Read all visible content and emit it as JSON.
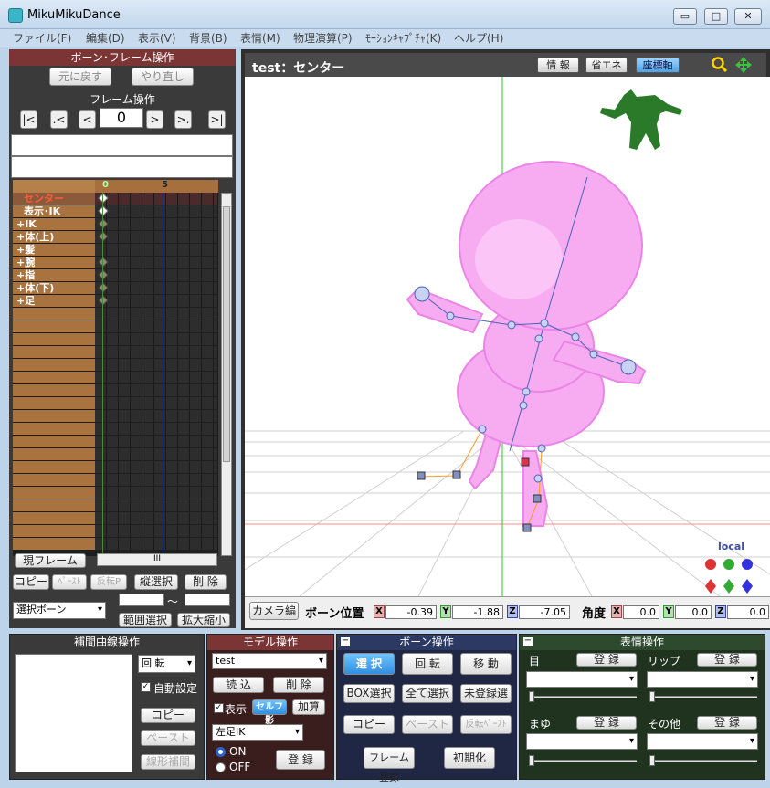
{
  "window": {
    "title": "MikuMikuDance",
    "minimize": "▭",
    "maximize": "□",
    "close": "✕"
  },
  "menu": [
    "ファイル(F)",
    "編集(D)",
    "表示(V)",
    "背景(B)",
    "表情(M)",
    "物理演算(P)",
    "ﾓｰｼｮﾝｷｬﾌﾟﾁｬ(K)",
    "ヘルプ(H)"
  ],
  "bone_frame_ops": {
    "title": "ボーン･フレーム操作",
    "undo": "元に戻す",
    "redo": "やり直し"
  },
  "frame_ops": {
    "title": "フレーム操作",
    "first": "|<",
    "prev_key": ".<",
    "prev": "<",
    "frame": "0",
    "next": ">",
    "next_key": ">.",
    "last": ">|"
  },
  "timeline": {
    "ruler": [
      "0",
      "5"
    ],
    "rows": [
      "センター",
      "表示･IK",
      "+IK",
      "+体(上)",
      "+髪",
      "+腕",
      "+指",
      "+体(下)",
      "+足"
    ],
    "current_frame": "現フレーム",
    "scroll_mid": "III",
    "copy": "コピー",
    "paste": "ﾍﾟｰｽﾄ",
    "reverse_paste": "反転P",
    "vertical_select": "縦選択",
    "delete": "削 除",
    "bone_select": "選択ボーン",
    "tilde": "～",
    "range_select": "範囲選択",
    "zoom": "拡大縮小"
  },
  "viewport": {
    "title": "test：センター",
    "info": "情 報",
    "eco": "省エネ",
    "axis": "座標軸",
    "local": "local",
    "camera_edit": "カメラ編",
    "bone_pos_label": "ボーン位置",
    "x": "X",
    "y": "Y",
    "z": "Z",
    "pos_x": "-0.39",
    "pos_y": "-1.88",
    "pos_z": "-7.05",
    "angle_label": "角度",
    "ang_x": "0.0",
    "ang_y": "0.0",
    "ang_z": "0.0"
  },
  "interp": {
    "title": "補間曲線操作",
    "rotate": "回 転",
    "auto": "自動設定",
    "copy": "コピー",
    "paste": "ペースト",
    "linear": "線形補間"
  },
  "model": {
    "title": "モデル操作",
    "model_name": "test",
    "load": "読 込",
    "delete": "削 除",
    "display": "表示",
    "self_shadow": "セルフ影",
    "add": "加算",
    "ik_name": "左足IK",
    "on": "ON",
    "off": "OFF",
    "register": "登 録"
  },
  "bone": {
    "title": "ボーン操作",
    "select": "選 択",
    "rotate": "回 転",
    "move": "移 動",
    "box_select": "BOX選択",
    "select_all": "全て選択",
    "unregistered": "未登録選",
    "copy": "コピー",
    "paste": "ペースト",
    "reverse_paste": "反転ﾍﾟｰｽﾄ",
    "frame_register": "フレーム登録",
    "initialize": "初期化"
  },
  "facial": {
    "title": "表情操作",
    "eye": "目",
    "lip": "リップ",
    "brow": "まゆ",
    "other": "その他",
    "register": "登 録"
  },
  "colors": {
    "title_red": "#7b3535",
    "bone_blue": "#2c3a63",
    "facial_green": "#2e4a2e",
    "viewport_bg": "#ffffff",
    "pink": "#f5a9f0"
  }
}
